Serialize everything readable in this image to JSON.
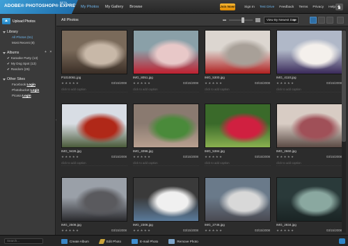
{
  "brand": {
    "name": "ADOBE® PHOTOSHOP® EXPRESS",
    "badge": "BETA"
  },
  "nav": {
    "tabs": [
      {
        "label": "My Photos",
        "active": true
      },
      {
        "label": "My Gallery",
        "active": false
      },
      {
        "label": "Browse",
        "active": false
      }
    ]
  },
  "top_right": {
    "join_label": "Join Now!",
    "links": [
      "Sign In",
      "Test Drive",
      "Feedback",
      "Terms",
      "Privacy",
      "Help ▾"
    ],
    "highlight_index": 1
  },
  "sidebar": {
    "upload_label": "Upload Photos",
    "library": {
      "heading": "Library",
      "items": [
        "All Photos (51)",
        "Most Recent (8)"
      ],
      "selected": 0
    },
    "albums": {
      "heading": "Albums",
      "add_symbol": "+",
      "remove_symbol": "×",
      "items": [
        "Karaoke Party (13)",
        "My Dog Spot (13)",
        "Random (25)"
      ]
    },
    "other_sites": {
      "heading": "Other Sites",
      "items": [
        {
          "name": "Facebook",
          "action": "Login"
        },
        {
          "name": "Photobucket",
          "action": "Login"
        },
        {
          "name": "Picasa",
          "action": "Login"
        }
      ]
    }
  },
  "toolbar": {
    "title": "All Photos",
    "sort_value": "View By Newest Date",
    "zoom_level": 0.6
  },
  "search": {
    "placeholder": "Search..."
  },
  "bottom_actions": [
    "Create Album",
    "Edit Photo",
    "E-mail Photo",
    "Remove Photo"
  ],
  "photos": [
    {
      "file": "P1010061.jpg",
      "date": "03/15/2008",
      "caption": "click to add caption",
      "colors": [
        "#7a6a5a",
        "#c8b8a8",
        "#3a2e26"
      ]
    },
    {
      "file": "IMG_8051.jpg",
      "date": "03/15/2008",
      "caption": "click to add caption",
      "colors": [
        "#8aa0a8",
        "#e8c8c8",
        "#c02030"
      ]
    },
    {
      "file": "IMG_5300.jpg",
      "date": "03/15/2008",
      "caption": "click to add caption",
      "colors": [
        "#dcd6d0",
        "#a8a098",
        "#b02020"
      ]
    },
    {
      "file": "IMG_4110.jpg",
      "date": "03/15/2008",
      "caption": "click to add caption",
      "colors": [
        "#b0b8c8",
        "#f4f0ec",
        "#3a2a5a"
      ]
    },
    {
      "file": "IMG_9426.jpg",
      "date": "03/15/2008",
      "caption": "click to add caption",
      "colors": [
        "#d8dde4",
        "#b02818",
        "#4a5a3a"
      ]
    },
    {
      "file": "IMG_4096.jpg",
      "date": "03/15/2008",
      "caption": "click to add caption",
      "colors": [
        "#8a7a70",
        "#4a8a3a",
        "#b8a090"
      ]
    },
    {
      "file": "IMG_5384.jpg",
      "date": "03/15/2008",
      "caption": "click to add caption",
      "colors": [
        "#3a6a2a",
        "#d02040",
        "#8ab050"
      ]
    },
    {
      "file": "IMG_2660.jpg",
      "date": "03/15/2008",
      "caption": "click to add caption",
      "colors": [
        "#d8ccc4",
        "#a05058",
        "#5a4a44"
      ]
    },
    {
      "file": "IMG_2508.jpg",
      "date": "03/15/2008",
      "caption": "click to add caption",
      "colors": [
        "#9aa0a8",
        "#5a5a5e",
        "#2a2a2e"
      ]
    },
    {
      "file": "IMG_2306.jpg",
      "date": "03/15/2008",
      "caption": "click to add caption",
      "colors": [
        "#3a3a3a",
        "#f0f0f0",
        "#5a7a9a"
      ]
    },
    {
      "file": "IMG_2746.jpg",
      "date": "03/15/2008",
      "caption": "click to add caption",
      "colors": [
        "#6a7a8a",
        "#d8d8d8",
        "#4a4a52"
      ]
    },
    {
      "file": "IMG_2834.jpg",
      "date": "03/15/2008",
      "caption": "click to add caption",
      "colors": [
        "#2a3a3a",
        "#8aa8a0",
        "#1a2424"
      ]
    }
  ],
  "colors": {
    "accent": "#6fb6ec",
    "join": "#f0a020",
    "background": "#2c2c2c"
  }
}
